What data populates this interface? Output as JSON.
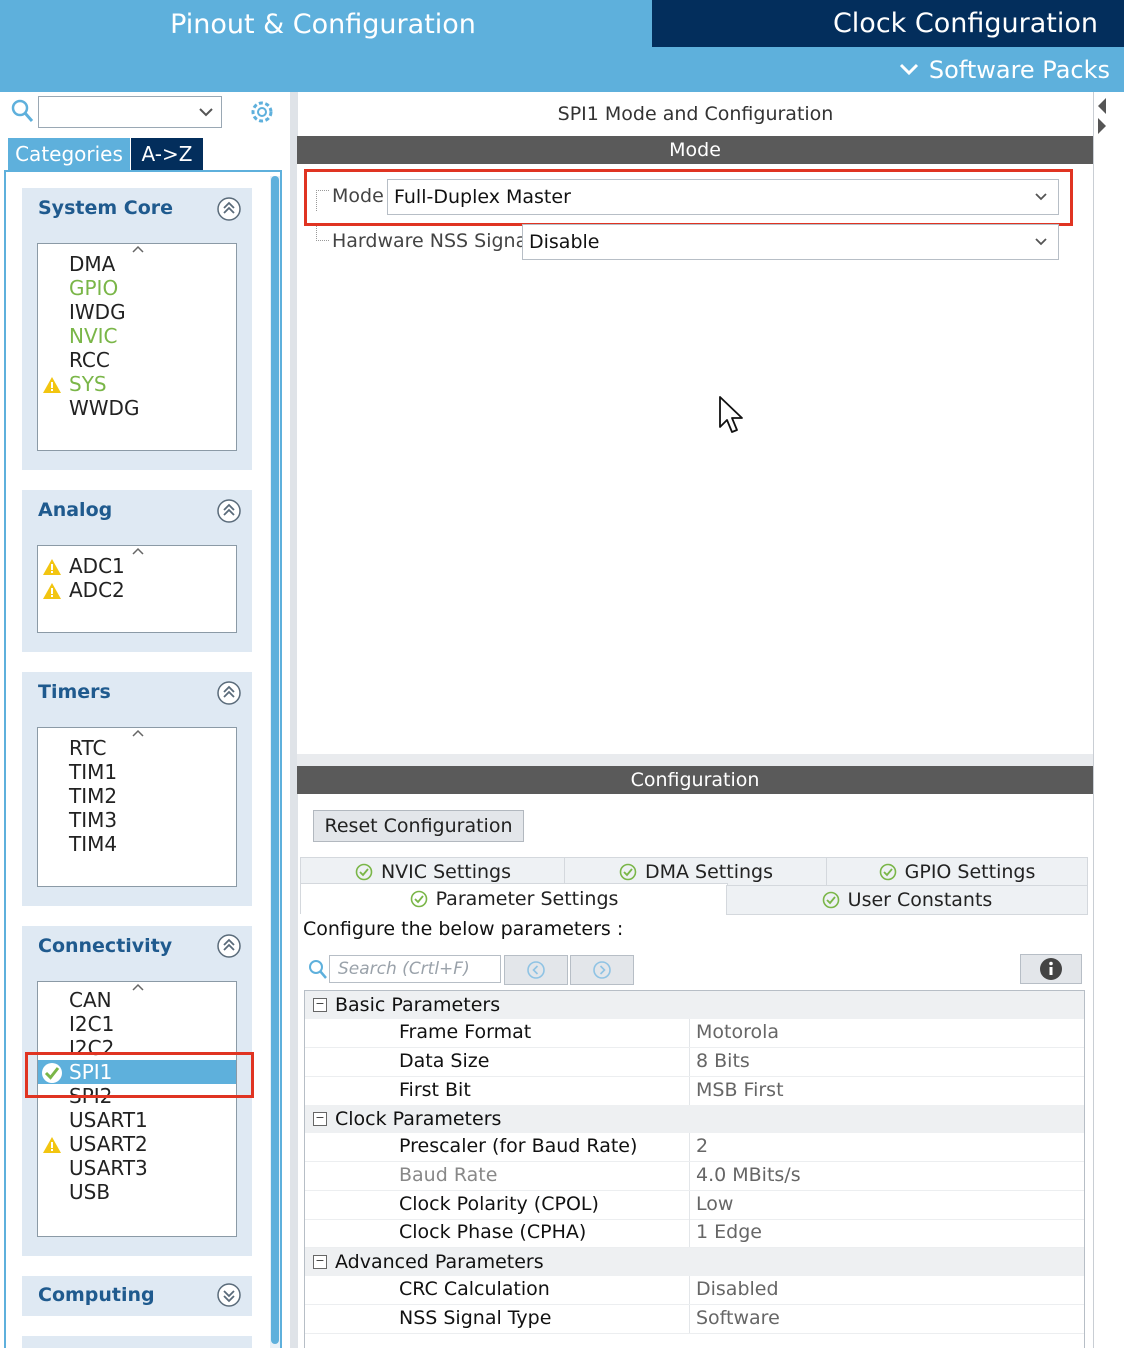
{
  "header": {
    "tab_pinout": "Pinout & Configuration",
    "tab_clock": "Clock Configuration",
    "software_packs": "Software Packs"
  },
  "sidebar": {
    "search_value": "",
    "tab_categories": "Categories",
    "tab_az": "A->Z",
    "sections": {
      "system_core": {
        "title": "System Core",
        "items": [
          "DMA",
          "GPIO",
          "IWDG",
          "NVIC",
          "RCC",
          "SYS",
          "WWDG"
        ]
      },
      "analog": {
        "title": "Analog",
        "items": [
          "ADC1",
          "ADC2"
        ]
      },
      "timers": {
        "title": "Timers",
        "items": [
          "RTC",
          "TIM1",
          "TIM2",
          "TIM3",
          "TIM4"
        ]
      },
      "connectivity": {
        "title": "Connectivity",
        "items": [
          "CAN",
          "I2C1",
          "I2C2",
          "SPI1",
          "SPI2",
          "USART1",
          "USART2",
          "USART3",
          "USB"
        ],
        "selected": "SPI1"
      },
      "computing": {
        "title": "Computing"
      }
    }
  },
  "main": {
    "panel_title": "SPI1 Mode and Configuration",
    "mode_header": "Mode",
    "mode_label": "Mode",
    "mode_value": "Full-Duplex Master",
    "nss_label": "Hardware NSS Signal",
    "nss_value": "Disable",
    "config_header": "Configuration",
    "reset_button": "Reset Configuration",
    "tabs": {
      "nvic": "NVIC Settings",
      "dma": "DMA Settings",
      "gpio": "GPIO Settings",
      "parameter": "Parameter Settings",
      "user_constants": "User Constants"
    },
    "intro": "Configure the below parameters :",
    "search_placeholder": "Search (Crtl+F)",
    "groups": {
      "basic": {
        "title": "Basic Parameters",
        "rows": [
          {
            "key": "Frame Format",
            "value": "Motorola"
          },
          {
            "key": "Data Size",
            "value": "8 Bits"
          },
          {
            "key": "First Bit",
            "value": "MSB First"
          }
        ]
      },
      "clock": {
        "title": "Clock Parameters",
        "rows": [
          {
            "key": "Prescaler (for Baud Rate)",
            "value": "2"
          },
          {
            "key": "Baud Rate",
            "value": "4.0 MBits/s"
          },
          {
            "key": "Clock Polarity (CPOL)",
            "value": "Low"
          },
          {
            "key": "Clock Phase (CPHA)",
            "value": "1 Edge"
          }
        ]
      },
      "advanced": {
        "title": "Advanced Parameters",
        "rows": [
          {
            "key": "CRC Calculation",
            "value": "Disabled"
          },
          {
            "key": "NSS Signal Type",
            "value": "Software"
          }
        ]
      }
    }
  },
  "colors": {
    "accent": "#5eb0dc",
    "dark_tab": "#032e5c",
    "highlight_red": "#e03422",
    "ok_green": "#7ab648",
    "warning_yellow": "#f2c511"
  }
}
